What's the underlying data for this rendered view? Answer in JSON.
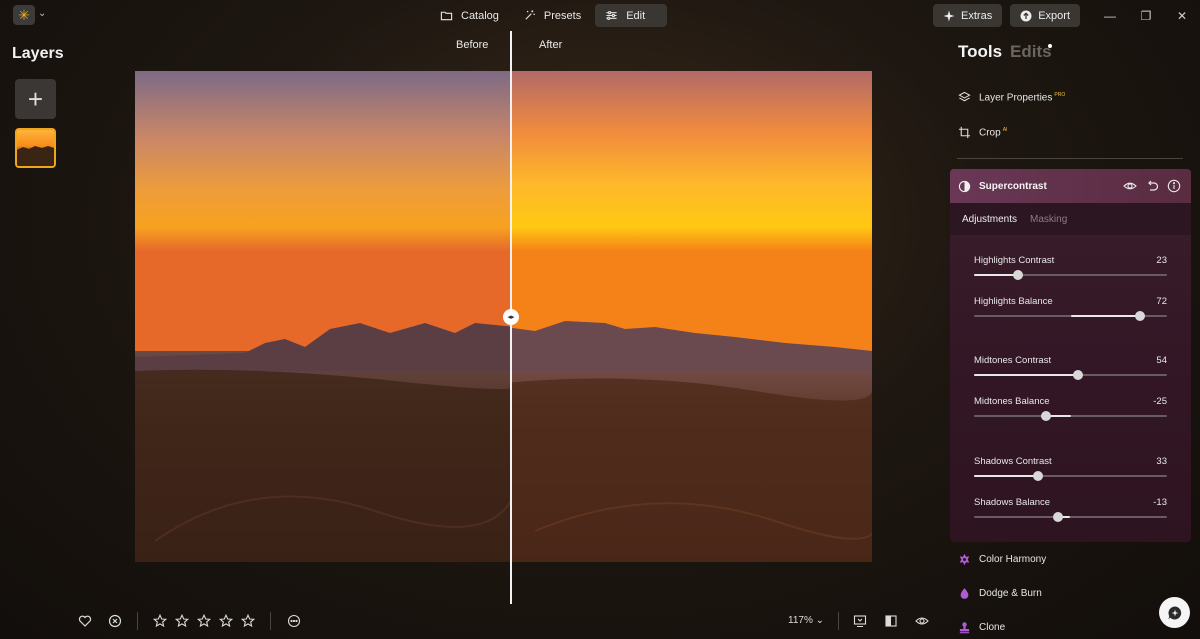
{
  "topbar": {
    "logo_glyph": "✳",
    "caret": "⌄",
    "tabs": [
      {
        "label": "Catalog",
        "icon": "folder-icon",
        "active": false
      },
      {
        "label": "Presets",
        "icon": "magic-wand-icon",
        "active": false
      },
      {
        "label": "Edit",
        "icon": "sliders-icon",
        "active": true
      }
    ],
    "extras_label": "Extras",
    "export_label": "Export",
    "window": {
      "minimize": "—",
      "maximize": "❐",
      "close": "✕"
    }
  },
  "layers": {
    "title": "Layers",
    "add_glyph": "+"
  },
  "canvas": {
    "before_label": "Before",
    "after_label": "After",
    "handle_glyph": "◂▸"
  },
  "bottombar": {
    "zoom": "117%",
    "zoom_caret": "⌄",
    "rating_stars": 5
  },
  "tools_panel": {
    "tools_tab": "Tools",
    "edits_tab": "Edits",
    "items_top": [
      {
        "label": "Layer Properties",
        "badge": "PRO",
        "icon": "layers-icon"
      },
      {
        "label": "Crop",
        "badge": "AI",
        "icon": "crop-icon"
      }
    ],
    "supercontrast": {
      "title": "Supercontrast",
      "subtabs": [
        "Adjustments",
        "Masking"
      ],
      "sliders": [
        {
          "label": "Highlights Contrast",
          "value": 23,
          "min": 0,
          "max": 100,
          "bipolar": false
        },
        {
          "label": "Highlights Balance",
          "value": 72,
          "min": -100,
          "max": 100,
          "bipolar": true
        },
        {
          "label": "Midtones Contrast",
          "value": 54,
          "min": 0,
          "max": 100,
          "bipolar": false
        },
        {
          "label": "Midtones Balance",
          "value": -25,
          "min": -100,
          "max": 100,
          "bipolar": true
        },
        {
          "label": "Shadows Contrast",
          "value": 33,
          "min": 0,
          "max": 100,
          "bipolar": false
        },
        {
          "label": "Shadows Balance",
          "value": -13,
          "min": -100,
          "max": 100,
          "bipolar": true
        }
      ]
    },
    "items_bottom": [
      {
        "label": "Color Harmony",
        "icon": "color-harmony-icon",
        "color": "#b05ad8"
      },
      {
        "label": "Dodge & Burn",
        "icon": "droplet-icon",
        "color": "#b05ad8"
      },
      {
        "label": "Clone",
        "icon": "clone-stamp-icon",
        "color": "#b05ad8"
      }
    ]
  },
  "colors": {
    "accent": "#f0a51d",
    "panel_header": "#6a3856",
    "tool_icon": "#b05ad8"
  }
}
